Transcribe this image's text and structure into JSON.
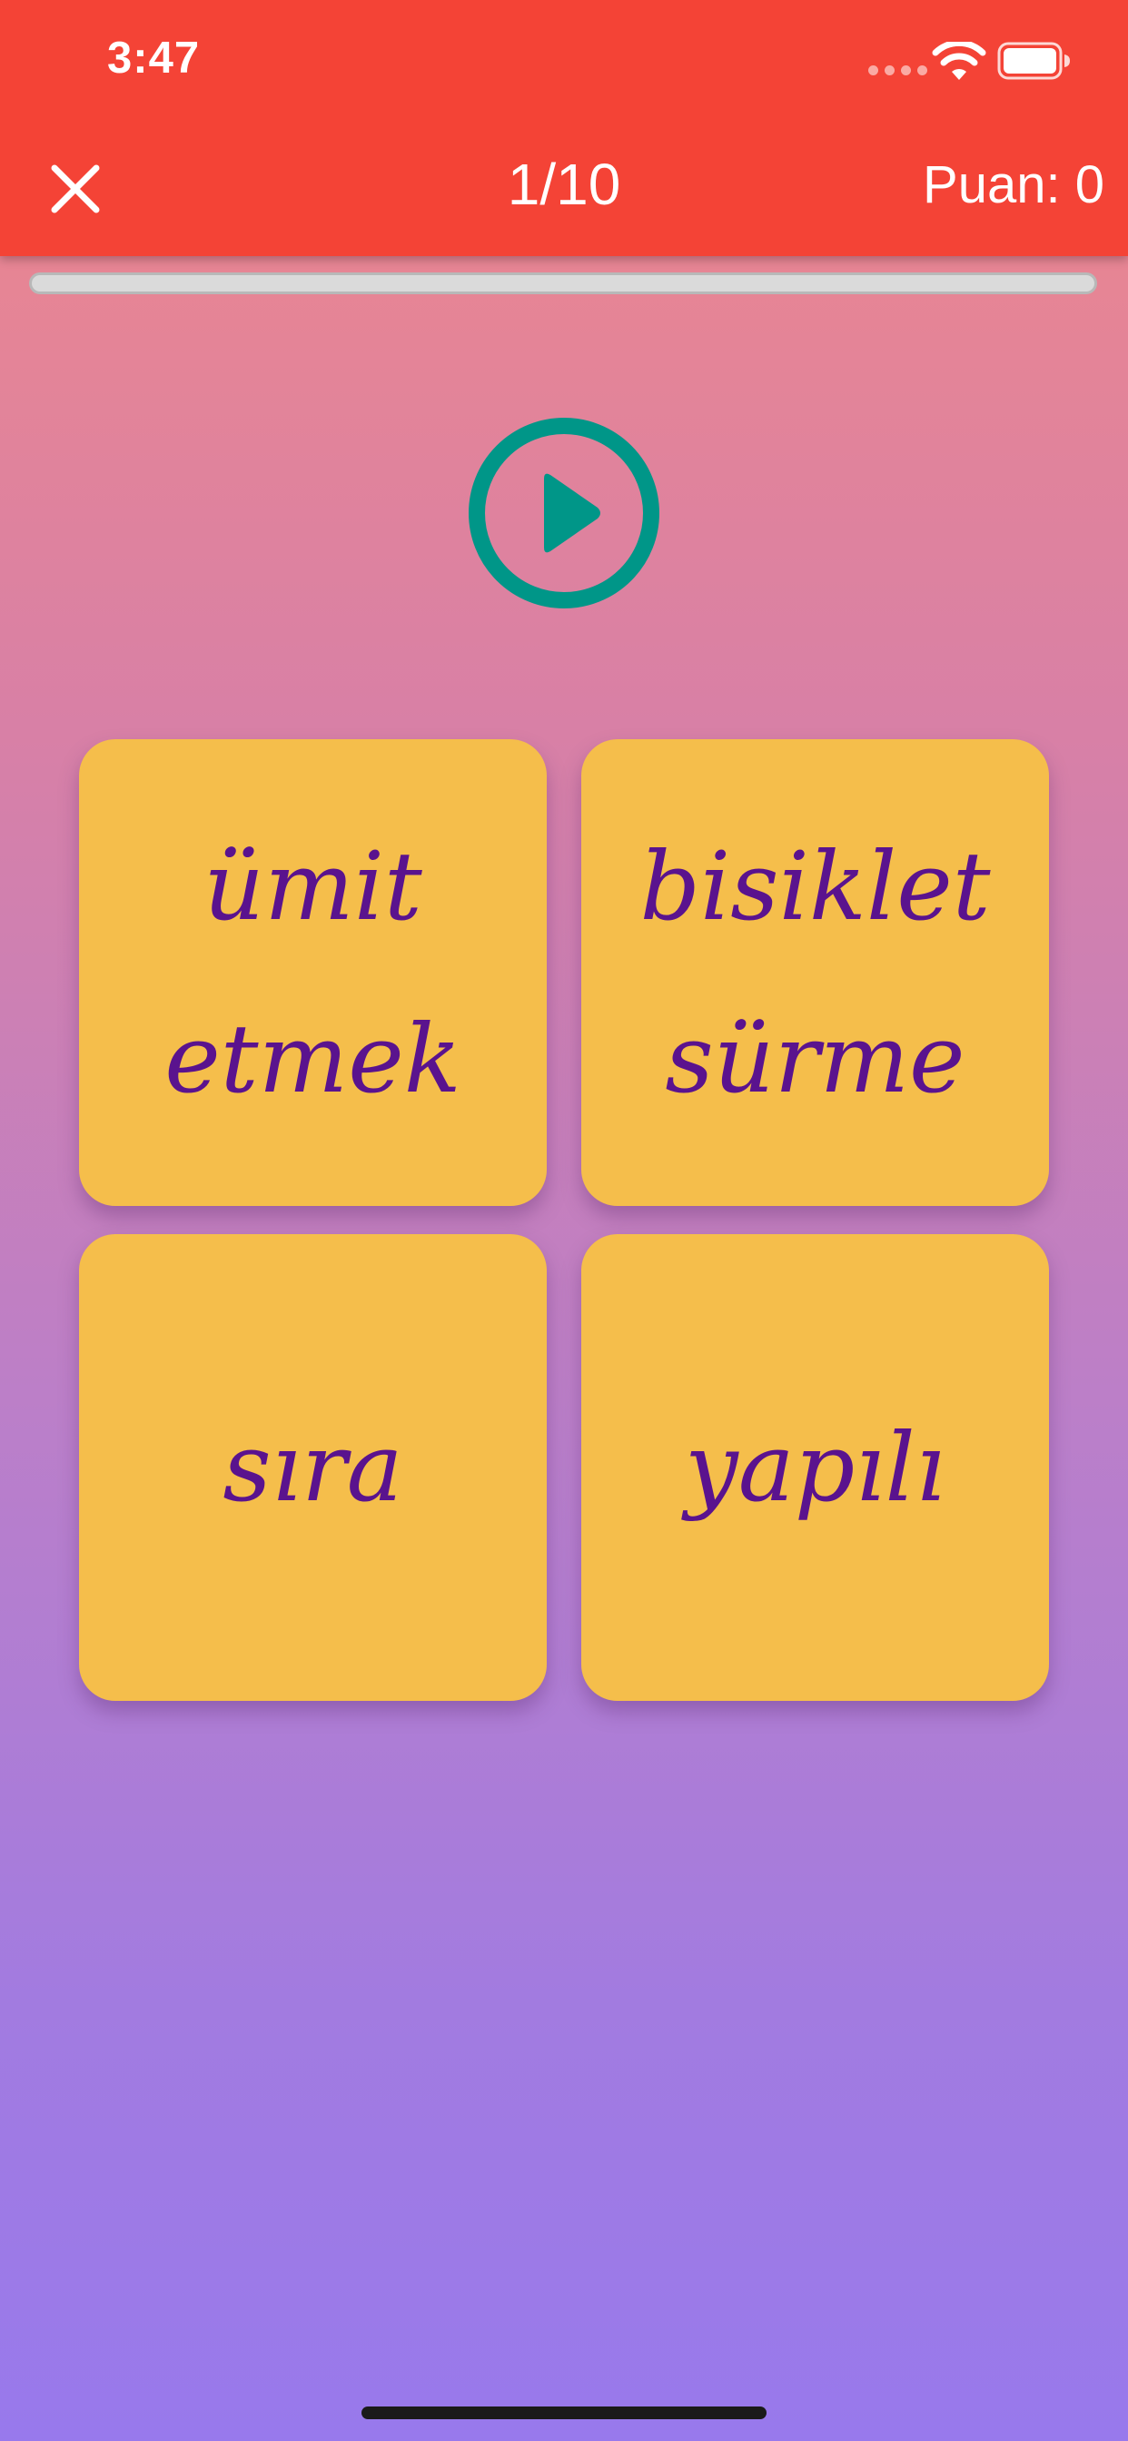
{
  "status_bar": {
    "time": "3:47"
  },
  "app_bar": {
    "background_color": "#f44336",
    "close_icon": "close-icon",
    "counter": "1/10",
    "score": "Puan: 0"
  },
  "progress": {
    "value": 0
  },
  "play": {
    "icon": "play-icon",
    "color": "#009688"
  },
  "answers": [
    {
      "label": "ümit etmek"
    },
    {
      "label": "bisiklet sürme"
    },
    {
      "label": "sıra"
    },
    {
      "label": "yapılı"
    }
  ],
  "colors": {
    "card": "#f5be4b",
    "card_text": "#5a138e"
  }
}
